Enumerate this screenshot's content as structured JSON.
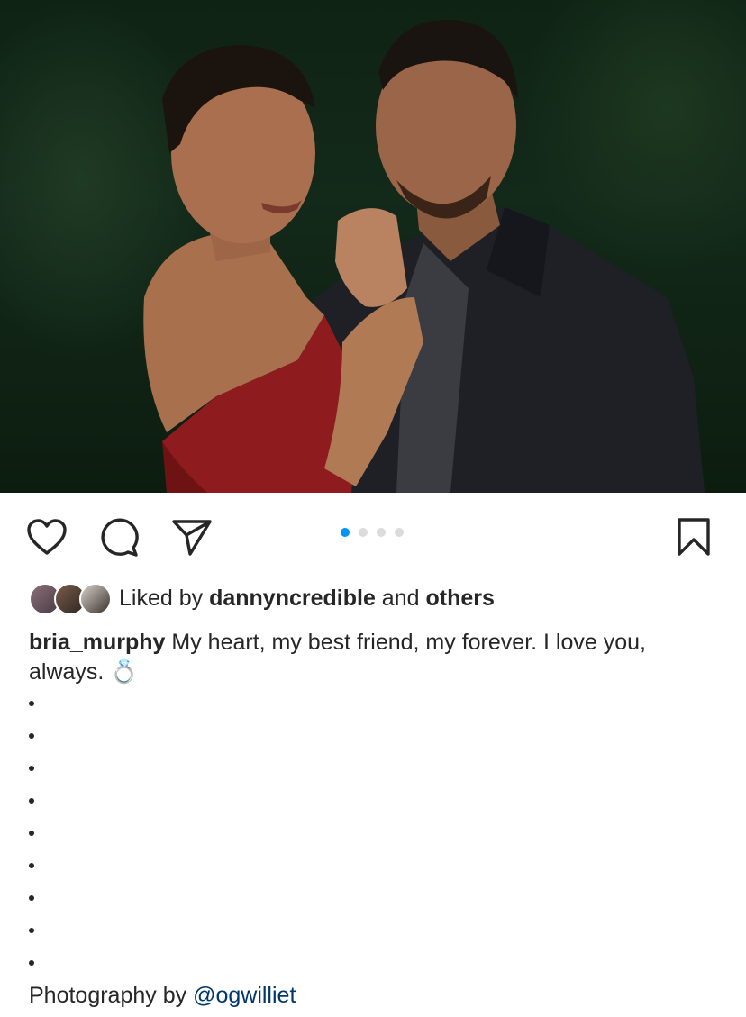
{
  "post": {
    "image": {
      "carousel_count": 4,
      "carousel_active_index": 1
    },
    "actions": {
      "like_icon": "heart-icon",
      "comment_icon": "comment-icon",
      "share_icon": "paper-plane-icon",
      "save_icon": "bookmark-icon"
    },
    "likes": {
      "prefix": "Liked by",
      "user": "dannyncredible",
      "conjunction": "and",
      "others": "others"
    },
    "caption": {
      "username": "bria_murphy",
      "text": "My heart, my best friend, my forever. I love you, always. 💍",
      "bullets": [
        "•",
        "•",
        "•",
        "•",
        "•",
        "•",
        "•",
        "•",
        "•"
      ],
      "credit_prefix": "Photography by",
      "credit_handle": "@ogwilliet"
    },
    "colors": {
      "accent": "#0095f6",
      "text": "#262626",
      "link": "#00376b",
      "inactive_dot": "#dbdbdb"
    }
  }
}
